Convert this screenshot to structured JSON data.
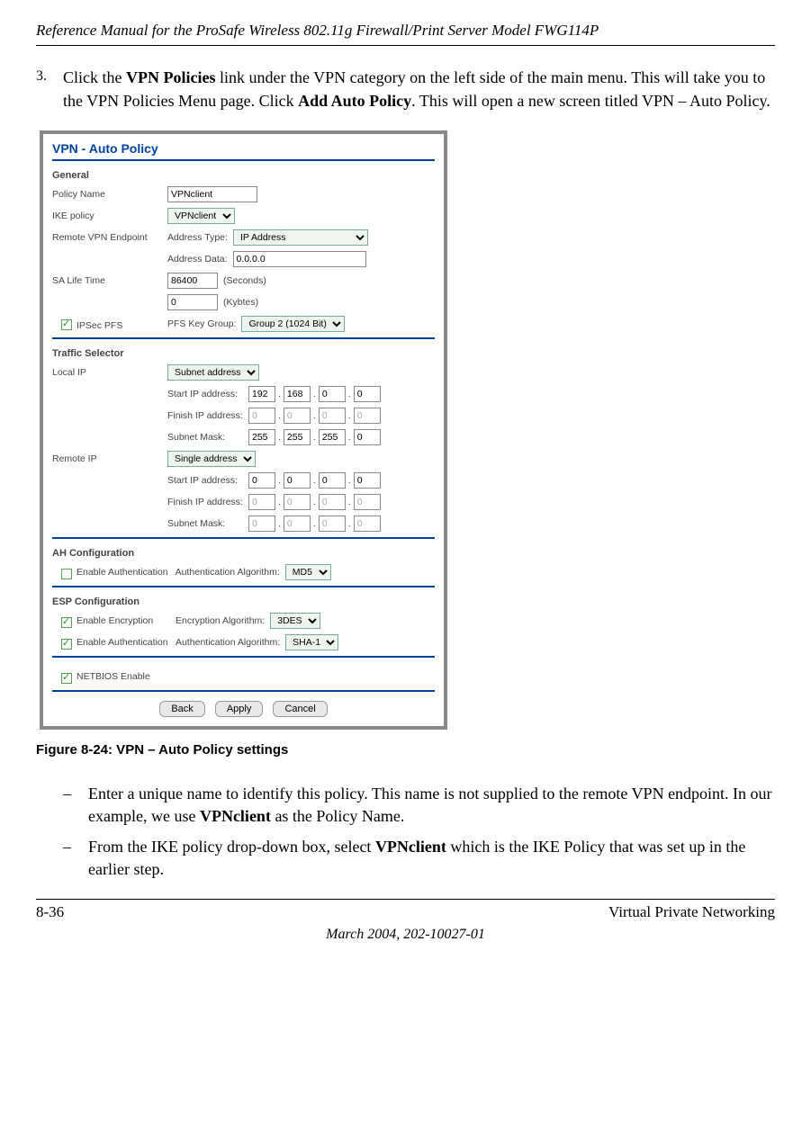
{
  "header": {
    "title": "Reference Manual for the ProSafe Wireless 802.11g  Firewall/Print Server Model FWG114P"
  },
  "step": {
    "num": "3.",
    "text_before_bold1": "Click the ",
    "bold1": "VPN Policies",
    "text_mid1": " link under the VPN category on the left side of the main menu. This will take you to the VPN Policies Menu page. Click ",
    "bold2": "Add Auto Policy",
    "text_after": ". This will open a new screen titled VPN – Auto Policy."
  },
  "screenshot": {
    "title": "VPN - Auto Policy",
    "general": {
      "heading": "General",
      "policy_name_label": "Policy Name",
      "policy_name_value": "VPNclient",
      "ike_policy_label": "IKE policy",
      "ike_policy_value": "VPNclient",
      "remote_vpn_label": "Remote VPN Endpoint",
      "address_type_label": "Address Type:",
      "address_type_value": "IP Address",
      "address_data_label": "Address Data:",
      "address_data_value": "0.0.0.0",
      "sa_life_label": "SA Life Time",
      "sa_seconds_value": "86400",
      "sa_seconds_unit": "(Seconds)",
      "sa_kbytes_value": "0",
      "sa_kbytes_unit": "(Kybtes)",
      "ipsec_pfs_label": "IPSec PFS",
      "pfs_key_group_label": "PFS Key Group:",
      "pfs_key_group_value": "Group 2 (1024 Bit)"
    },
    "traffic": {
      "heading": "Traffic Selector",
      "local_ip_label": "Local IP",
      "local_type": "Subnet address",
      "start_ip_label": "Start IP address:",
      "finish_ip_label": "Finish IP address:",
      "subnet_mask_label": "Subnet Mask:",
      "local_start": [
        "192",
        "168",
        "0",
        "0"
      ],
      "local_finish": [
        "0",
        "0",
        "0",
        "0"
      ],
      "local_mask": [
        "255",
        "255",
        "255",
        "0"
      ],
      "remote_ip_label": "Remote IP",
      "remote_type": "Single address",
      "remote_start": [
        "0",
        "0",
        "0",
        "0"
      ],
      "remote_finish": [
        "0",
        "0",
        "0",
        "0"
      ],
      "remote_mask": [
        "0",
        "0",
        "0",
        "0"
      ]
    },
    "ah": {
      "heading": "AH Configuration",
      "enable_auth_label": "Enable Authentication",
      "auth_algo_label": "Authentication Algorithm:",
      "auth_algo_value": "MD5"
    },
    "esp": {
      "heading": "ESP Configuration",
      "enable_enc_label": "Enable Encryption",
      "enc_algo_label": "Encryption Algorithm:",
      "enc_algo_value": "3DES",
      "enable_auth_label": "Enable Authentication",
      "auth_algo_label": "Authentication Algorithm:",
      "auth_algo_value": "SHA-1"
    },
    "netbios_label": "NETBIOS Enable",
    "buttons": {
      "back": "Back",
      "apply": "Apply",
      "cancel": "Cancel"
    }
  },
  "figure_caption": "Figure 8-24:  VPN – Auto Policy  settings",
  "bullet1": {
    "t1": "Enter a unique name to identify this policy. This name is not supplied to the remote VPN endpoint. In our example, we use ",
    "b": "VPNclient",
    "t2": " as the Policy Name."
  },
  "bullet2": {
    "t1": "From the IKE policy drop-down box, select ",
    "b": "VPNclient",
    "t2": " which is the IKE Policy that was set up in the earlier step."
  },
  "footer": {
    "page": "8-36",
    "section": "Virtual Private Networking",
    "date": "March 2004, 202-10027-01"
  }
}
